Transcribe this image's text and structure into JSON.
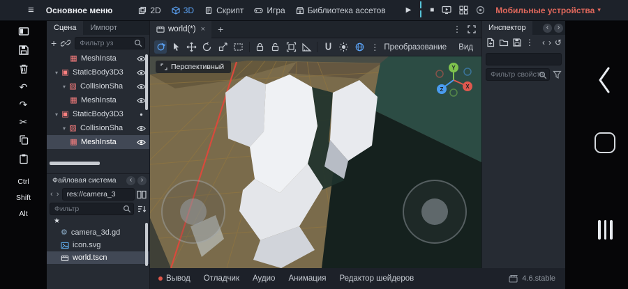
{
  "colors": {
    "accent_blue": "#5ba2f4",
    "node_red": "#fc7f7f",
    "debug_target_red": "#e0685c",
    "selection_gray": "#414855",
    "viewport_floor_tan": "#7a6b4b",
    "viewport_wall_teal": "#2c4c44"
  },
  "glyphs": {
    "menu": "≡",
    "caret_down": "▾",
    "play": "▶",
    "stop": "■",
    "dots_vertical": "⋮",
    "plus": "+",
    "close": "×",
    "collapse": "▾",
    "chevron_left": "‹",
    "chevron_right": "›",
    "undo": "↶",
    "redo": "↷",
    "cut": "✂",
    "history": "↺",
    "star": "★",
    "gear": "⚙"
  },
  "topbar": {
    "main_menu_label": "Основное меню",
    "workspaces": [
      {
        "label": "2D"
      },
      {
        "label": "3D"
      },
      {
        "label": "Скрипт"
      },
      {
        "label": "Игра"
      },
      {
        "label": "Библиотека ассетов"
      }
    ],
    "debug_target_label": "Мобильные устройства"
  },
  "left_toolbar": {
    "modifier_keys": [
      "Ctrl",
      "Shift",
      "Alt"
    ]
  },
  "scene_dock": {
    "tabs": [
      {
        "label": "Сцена"
      },
      {
        "label": "Импорт"
      }
    ],
    "filter_placeholder": "Фильтр уз",
    "tree": [
      {
        "name": "MeshInsta",
        "type": "MeshInstance3D"
      },
      {
        "name": "StaticBody3D3",
        "type": "StaticBody3D"
      },
      {
        "name": "CollisionSha",
        "type": "CollisionShape3D"
      },
      {
        "name": "MeshInsta",
        "type": "MeshInstance3D"
      },
      {
        "name": "StaticBody3D3",
        "type": "StaticBody3D"
      },
      {
        "name": "CollisionSha",
        "type": "CollisionShape3D"
      },
      {
        "name": "MeshInsta",
        "type": "MeshInstance3D",
        "selected": true
      }
    ]
  },
  "filesystem_dock": {
    "title": "Файловая система",
    "path_value": "res://camera_3",
    "filter_placeholder": "Фильтр",
    "files": [
      {
        "name": "camera_3d.gd"
      },
      {
        "name": "icon.svg"
      },
      {
        "name": "world.tscn",
        "selected": true
      }
    ]
  },
  "scene_tabs": {
    "tabs": [
      {
        "label": "world(*)"
      }
    ]
  },
  "viewport": {
    "perspective_label": "Перспективный",
    "transform_menu": "Преобразование",
    "view_menu": "Вид",
    "axis_labels": {
      "x": "X",
      "y": "Y",
      "z": "Z"
    }
  },
  "bottom_panel": {
    "tabs": [
      {
        "label": "Вывод"
      },
      {
        "label": "Отладчик"
      },
      {
        "label": "Аудио"
      },
      {
        "label": "Анимация"
      },
      {
        "label": "Редактор шейдеров"
      }
    ],
    "version": "4.6.stable"
  },
  "inspector": {
    "tab_label": "Инспектор",
    "filter_placeholder": "Фильтр свойств"
  },
  "node_icons": {
    "mesh_instance": "▦",
    "static_body": "▣",
    "collision_shape": "▨"
  }
}
